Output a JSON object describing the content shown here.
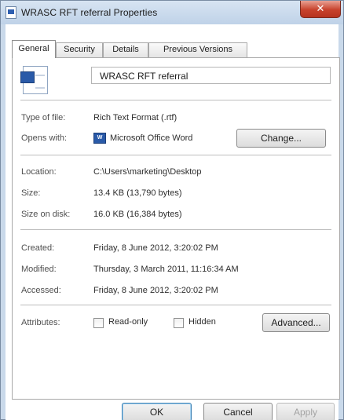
{
  "window": {
    "title": "WRASC RFT referral Properties",
    "close_glyph": "✕"
  },
  "tabs": [
    {
      "label": "General",
      "active": true
    },
    {
      "label": "Security",
      "active": false
    },
    {
      "label": "Details",
      "active": false
    },
    {
      "label": "Previous Versions",
      "active": false
    }
  ],
  "general": {
    "file_name": "WRASC RFT referral",
    "type_label": "Type of file:",
    "type_value": "Rich Text Format (.rtf)",
    "opens_label": "Opens with:",
    "opens_value": "Microsoft Office Word",
    "opens_icon_text": "W",
    "change_button": "Change...",
    "location_label": "Location:",
    "location_value": "C:\\Users\\marketing\\Desktop",
    "size_label": "Size:",
    "size_value": "13.4 KB (13,790 bytes)",
    "size_disk_label": "Size on disk:",
    "size_disk_value": "16.0 KB (16,384 bytes)",
    "created_label": "Created:",
    "created_value": "Friday, 8 June 2012, 3:20:02 PM",
    "modified_label": "Modified:",
    "modified_value": "Thursday, 3 March 2011, 11:16:34 AM",
    "accessed_label": "Accessed:",
    "accessed_value": "Friday, 8 June 2012, 3:20:02 PM",
    "attributes_label": "Attributes:",
    "readonly_label": "Read-only",
    "readonly_checked": false,
    "hidden_label": "Hidden",
    "hidden_checked": false,
    "advanced_button": "Advanced..."
  },
  "footer": {
    "ok": "OK",
    "cancel": "Cancel",
    "apply": "Apply"
  }
}
